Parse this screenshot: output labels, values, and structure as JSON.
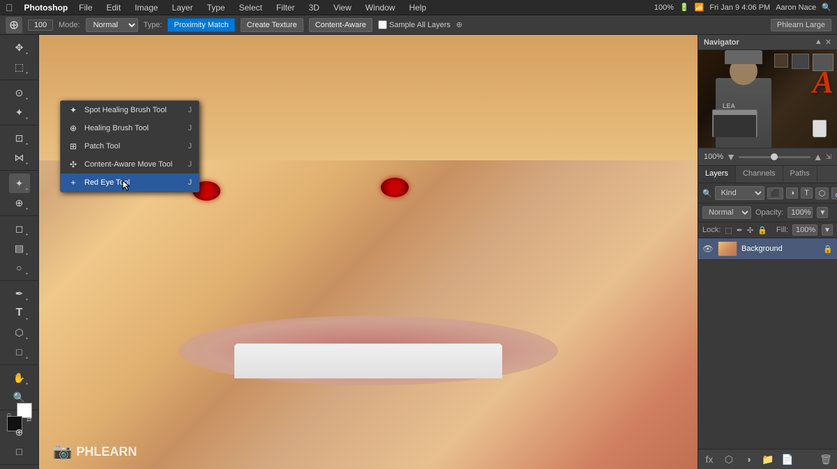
{
  "menubar": {
    "apple": "⌘",
    "app_name": "Photoshop",
    "menus": [
      "File",
      "Edit",
      "Image",
      "Layer",
      "Type",
      "Select",
      "Filter",
      "3D",
      "View",
      "Window",
      "Help"
    ],
    "right": {
      "resolution": "100%",
      "battery": "■",
      "wifi": "▲",
      "time": "Fri Jan 9  4:06 PM",
      "user": "Aaron Nace",
      "search": "🔍"
    }
  },
  "options_bar": {
    "tool_size": "100",
    "mode_label": "Mode:",
    "mode_value": "Normal",
    "type_label": "Type:",
    "type_proximity": "Proximity Match",
    "type_texture": "Create Texture",
    "type_content": "Content-Aware",
    "sample_all": "Sample All Layers",
    "panel_name": "Phlearn Large"
  },
  "tool_dropdown": {
    "items": [
      {
        "id": "spot-healing",
        "icon": "✦",
        "label": "Spot Healing Brush Tool",
        "shortcut": "J"
      },
      {
        "id": "healing-brush",
        "icon": "⊕",
        "label": "Healing Brush Tool",
        "shortcut": "J"
      },
      {
        "id": "patch",
        "icon": "⊞",
        "label": "Patch Tool",
        "shortcut": "J"
      },
      {
        "id": "content-aware-move",
        "icon": "✣",
        "label": "Content-Aware Move Tool",
        "shortcut": "J"
      },
      {
        "id": "red-eye",
        "icon": "+",
        "label": "Red Eye Tool",
        "shortcut": "J",
        "hovered": true
      }
    ]
  },
  "navigator": {
    "title": "Navigator",
    "zoom": "100%",
    "close_btn": "✕",
    "expand_btn": "▲"
  },
  "layers": {
    "tabs": [
      "Layers",
      "Channels",
      "Paths"
    ],
    "active_tab": "Layers",
    "search_placeholder": "Kind",
    "mode": "Normal",
    "opacity_label": "Opacity:",
    "opacity_value": "100%",
    "lock_label": "Lock:",
    "fill_label": "Fill:",
    "fill_value": "100%",
    "layer_items": [
      {
        "name": "Background",
        "visible": true,
        "locked": true
      }
    ],
    "bottom_actions": [
      "⟲",
      "fx",
      "□",
      "🗑",
      "+",
      "📁"
    ]
  },
  "watermark": {
    "icon": "📷",
    "text": "PHLEARN"
  }
}
